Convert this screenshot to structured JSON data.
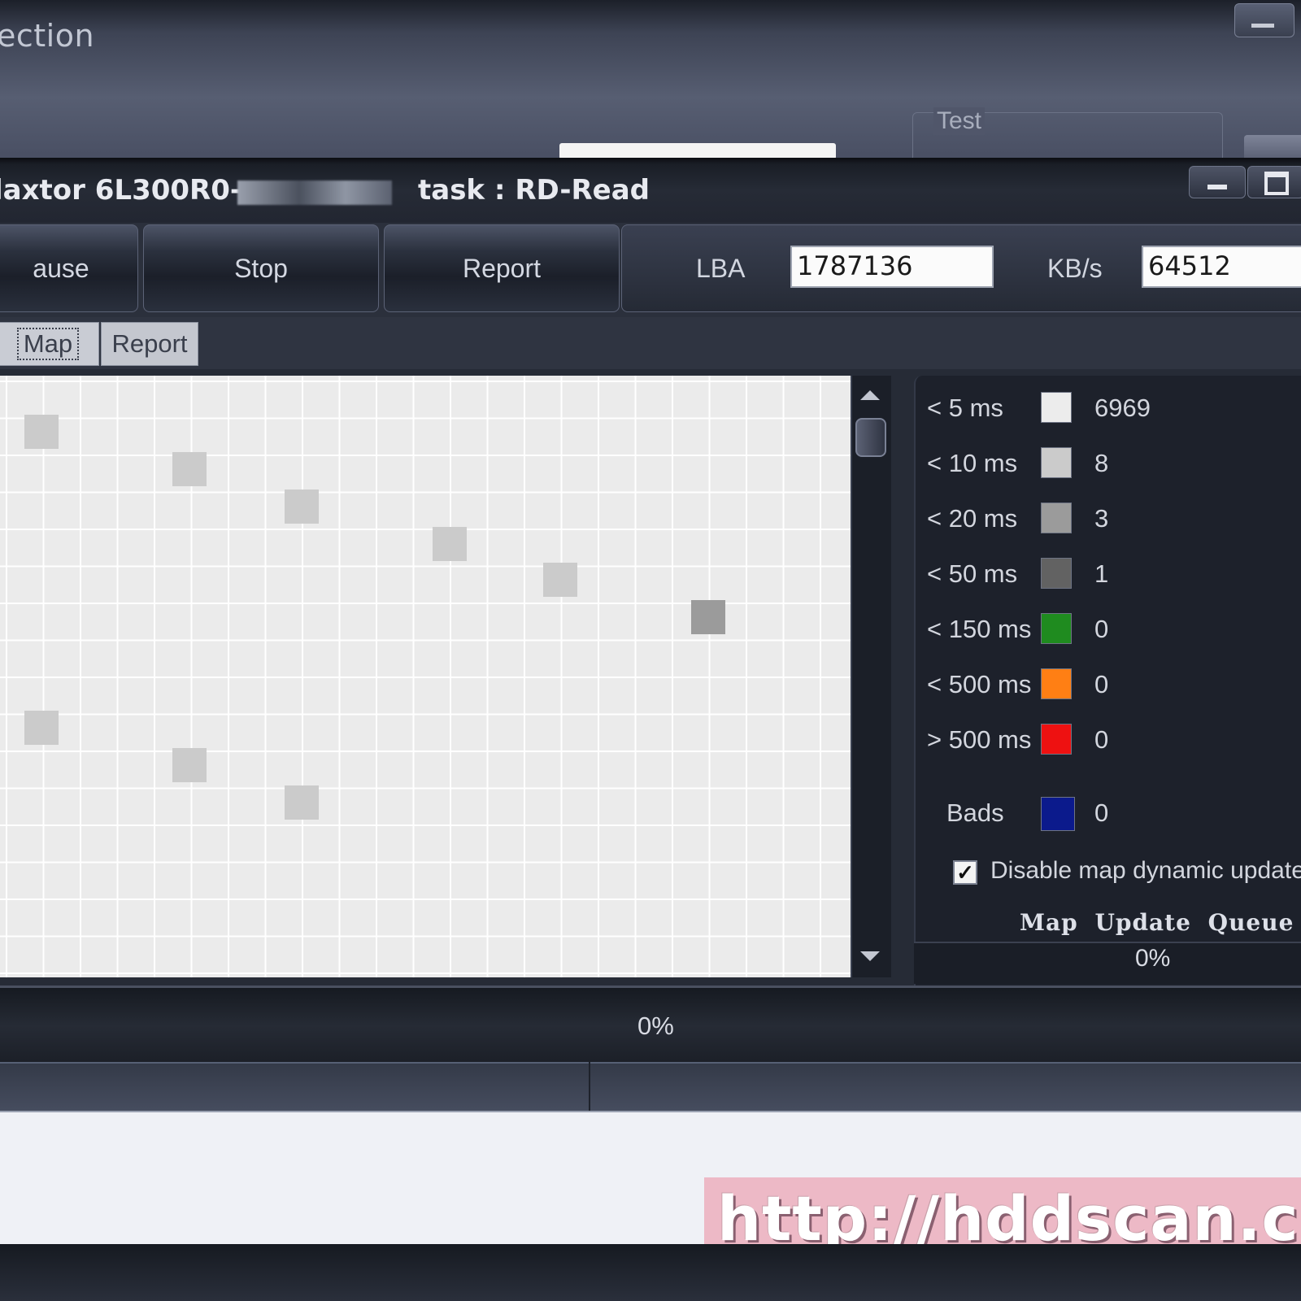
{
  "background_window": {
    "title": "ection",
    "group_label": "Test"
  },
  "window": {
    "drive_model": "laxtor 6L300R0-",
    "task": "task : RD-Read"
  },
  "toolbar": {
    "pause_label": "ause",
    "stop_label": "Stop",
    "report_label": "Report",
    "lba_label": "LBA",
    "lba_value": "1787136",
    "kbs_label": "KB/s",
    "kbs_value": "64512"
  },
  "tabs": [
    {
      "label": "Map",
      "selected": true
    },
    {
      "label": "Report",
      "selected": false
    }
  ],
  "legend": [
    {
      "label": "< 5 ms",
      "count": "6969",
      "color": "#ececec"
    },
    {
      "label": "< 10 ms",
      "count": "8",
      "color": "#cbcbcb"
    },
    {
      "label": "< 20 ms",
      "count": "3",
      "color": "#9b9b9b"
    },
    {
      "label": "< 50 ms",
      "count": "1",
      "color": "#626262"
    },
    {
      "label": "< 150 ms",
      "count": "0",
      "color": "#1f8b1f"
    },
    {
      "label": "< 500 ms",
      "count": "0",
      "color": "#ff7f14"
    },
    {
      "label": "> 500 ms",
      "count": "0",
      "color": "#ee1111"
    },
    {
      "label": "Bads",
      "count": "0",
      "color": "#0b1a8c"
    }
  ],
  "map_options": {
    "disable_update_label": "Disable map dynamic update",
    "disable_update_checked": true,
    "queue_title": "Map Update Queue",
    "queue_percent": "0%"
  },
  "progress": {
    "percent_text": "0%"
  },
  "watermark": {
    "text": "http://hddscan.c"
  }
}
